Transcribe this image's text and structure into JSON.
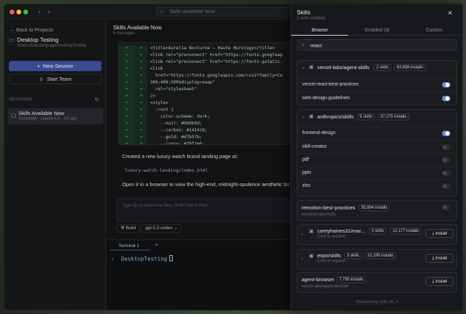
{
  "window": {
    "search_placeholder": "Skills Available Now"
  },
  "sidebar": {
    "back_label": "Back to Projects",
    "project_name": "Desktop Testing",
    "project_path": "/Users/iloveJanguage/DesktopTesting",
    "new_session_label": "New Session",
    "start_team_label": "Start Team",
    "sessions_heading": "SESSIONS",
    "session_title": "Skills Available Now",
    "session_subtitle": "Ghostlight · claude-4.5 · 2m ago"
  },
  "main": {
    "title": "Skills Available Now",
    "subtitle": "6 messages",
    "code_lines": [
      {
        "n": "+",
        "n2": "+",
        "text": "<title>Aurelia Nocturne — Haute Horology</title>"
      },
      {
        "n": "+",
        "n2": "+",
        "text": "<link rel=\"preconnect\" href=\"https://fonts.googleap"
      },
      {
        "n": "+",
        "n2": "+",
        "text": "<link rel=\"preconnect\" href=\"https://fonts.gstatic."
      },
      {
        "n": "+",
        "n2": "+",
        "text": "<link"
      },
      {
        "n": "+",
        "n2": "+",
        "text": "  href=\"https://fonts.googleapis.com/css2?family=Co"
      },
      {
        "n": "+",
        "n2": "+",
        "text": "300;400;500&display=swap\""
      },
      {
        "n": "+",
        "n2": "+",
        "text": "  rel=\"stylesheet\""
      },
      {
        "n": "+",
        "n2": "+",
        "text": "/>"
      },
      {
        "n": "+",
        "n2": "+",
        "text": "<style>"
      },
      {
        "n": "+",
        "n2": "+",
        "text": "  :root {"
      },
      {
        "n": "+",
        "n2": "+",
        "text": "    color-scheme: dark;"
      },
      {
        "n": "+",
        "n2": "+",
        "text": "    --noir: #0b0b0d;"
      },
      {
        "n": "+",
        "n2": "+",
        "text": "    --carbon: #141418;"
      },
      {
        "n": "+",
        "n2": "+",
        "text": "    --gold: #d7b57b;"
      },
      {
        "n": "+",
        "n2": "+",
        "text": "    --ivory: #f8f2e6;"
      }
    ],
    "message1": "Created a new luxury watch brand landing page at:",
    "message_path": "luxury-watch-landing/index.html",
    "message2": "Open it in a browser to view the high-end, midnight-opulence aesthetic for t",
    "input_placeholder": "Type @ to reference files, Shift+Tab to Plan",
    "chip_build": "Build",
    "chip_model": "gpt-5.2-codex",
    "terminal_tab": "Terminal 1",
    "terminal_prompt": "›",
    "terminal_text": "DesktopTesting"
  },
  "skills_panel": {
    "title": "Skills",
    "subtitle": "2 skills enabled",
    "tabs": [
      "Browse",
      "Enabled (3)",
      "Custom"
    ],
    "search_value": "react",
    "repo1": {
      "name": "vercel-labs/agent-skills",
      "skills": "2 skills",
      "installs": "92,658 installs",
      "items": [
        {
          "label": "vercel-react-best-practices",
          "on": true
        },
        {
          "label": "web-design-guidelines",
          "on": true
        }
      ]
    },
    "repo2": {
      "name": "anthropics/skills",
      "skills": "5 skills",
      "installs": "37,275 installs",
      "items": [
        {
          "label": "frontend-design",
          "on": true
        },
        {
          "label": "skill-creator",
          "on": false
        },
        {
          "label": "pdf",
          "on": false
        },
        {
          "label": "pptx",
          "on": false
        },
        {
          "label": "xlsx",
          "on": false
        }
      ]
    },
    "single1": {
      "name": "remotion-best-practices",
      "installs": "35,894 installs",
      "sub": "remotion-dev/skills"
    },
    "repo3": {
      "name": "coreyhaines31/mar...",
      "skills": "3 skills",
      "installs": "12,177 installs",
      "sub": "Click to expand"
    },
    "repo4": {
      "name": "expo/skills",
      "skills": "3 skills",
      "installs": "10,199 installs",
      "sub": "Click to expand"
    },
    "single2": {
      "name": "agent-browser",
      "installs": "7,795 installs",
      "sub": "vercel-labs/agent-browser"
    },
    "install_label": "Install",
    "powered_by": "Powered by skills.sh"
  }
}
